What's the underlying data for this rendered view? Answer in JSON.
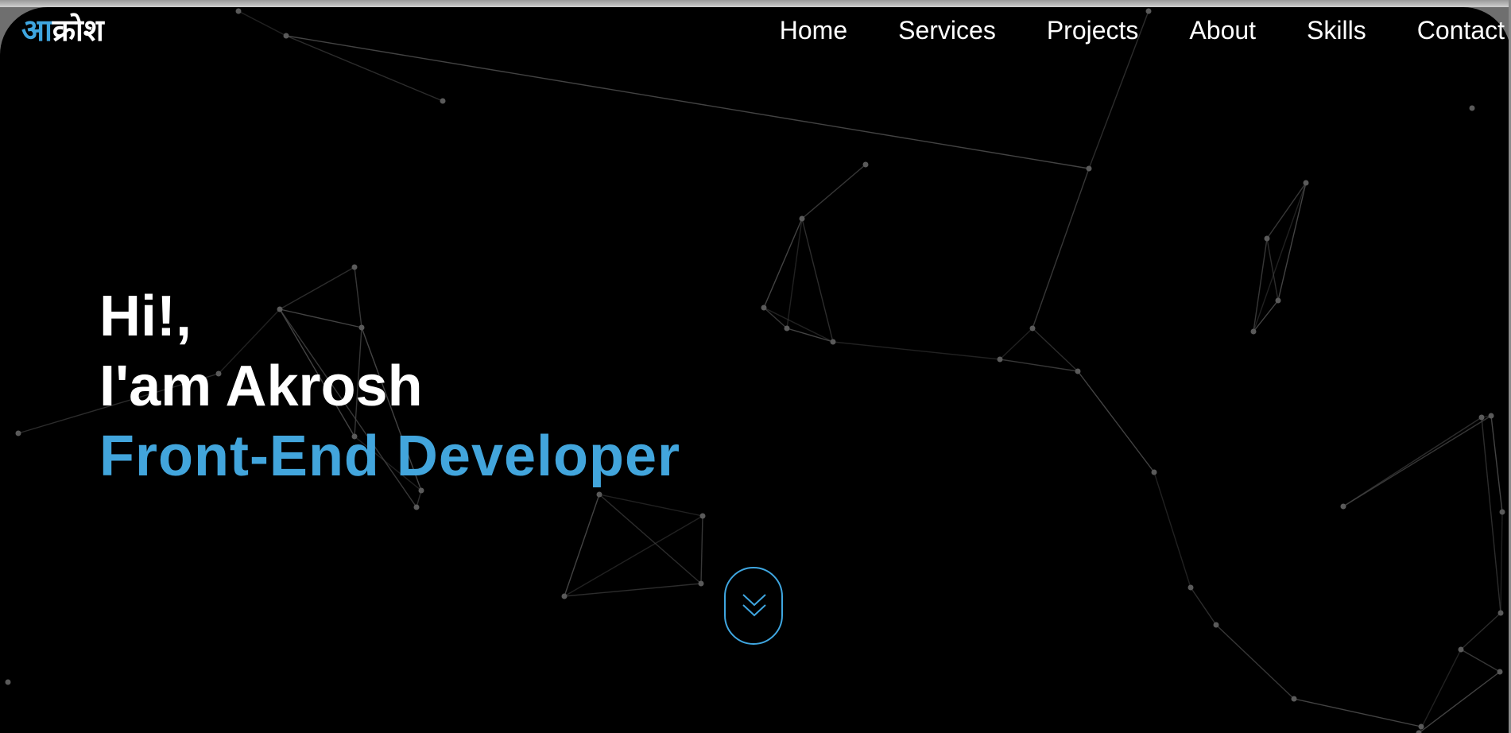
{
  "header": {
    "logo_accent": "आ",
    "logo_rest": "क्रोश"
  },
  "nav": {
    "items": [
      {
        "label": "Home"
      },
      {
        "label": "Services"
      },
      {
        "label": "Projects"
      },
      {
        "label": "About"
      },
      {
        "label": "Skills"
      },
      {
        "label": "Contact"
      }
    ]
  },
  "hero": {
    "greeting": "Hi!,",
    "name_line": "I'am Akrosh",
    "role": "Front-End Developer"
  },
  "scroll_button": {
    "icon": "double-chevron-down-icon"
  },
  "colors": {
    "accent": "#3fa6e0",
    "background": "#000000",
    "text": "#ffffff"
  }
}
